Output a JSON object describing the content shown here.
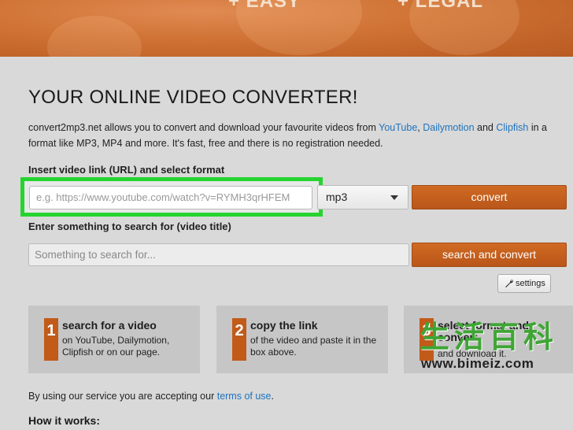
{
  "banner": {
    "left_text": "+ EASY",
    "right_text": "+ LEGAL"
  },
  "page": {
    "title": "YOUR ONLINE VIDEO CONVERTER!",
    "intro_part1": "convert2mp3.net allows you to convert and download your favourite videos from ",
    "intro_link1": "YouTube",
    "intro_sep1": ", ",
    "intro_link2": "Dailymotion",
    "intro_sep2": " and ",
    "intro_link3": "Clipfish",
    "intro_part2": " in a format like MP3, MP4 and more. It's fast, free and there is no registration needed."
  },
  "convert_form": {
    "label": "Insert video link (URL) and select format",
    "url_placeholder": "e.g. https://www.youtube.com/watch?v=RYMH3qrHFEM",
    "format_selected": "mp3",
    "convert_label": "convert"
  },
  "search_form": {
    "label": "Enter something to search for (video title)",
    "placeholder": "Something to search for...",
    "button_label": "search and convert"
  },
  "settings": {
    "label": "settings"
  },
  "steps": [
    {
      "number": "1",
      "title": "search for a video",
      "description": "on YouTube, Dailymotion, Clipfish or on our page."
    },
    {
      "number": "2",
      "title": "copy the link",
      "description": "of the video and paste it in the box above."
    },
    {
      "number": "3",
      "title": "select format and convert",
      "description": "and download it."
    }
  ],
  "footer": {
    "tos_text": "By using our service you are accepting our ",
    "tos_link": "terms of use",
    "tos_end": ".",
    "how_it_works": "How it works:"
  },
  "watermark": {
    "cn_text": "生活百科",
    "url": "www.bimeiz.com"
  },
  "colors": {
    "accent_orange": "#c25a1a",
    "highlight_green": "#25d42f",
    "link_blue": "#1e73be"
  }
}
